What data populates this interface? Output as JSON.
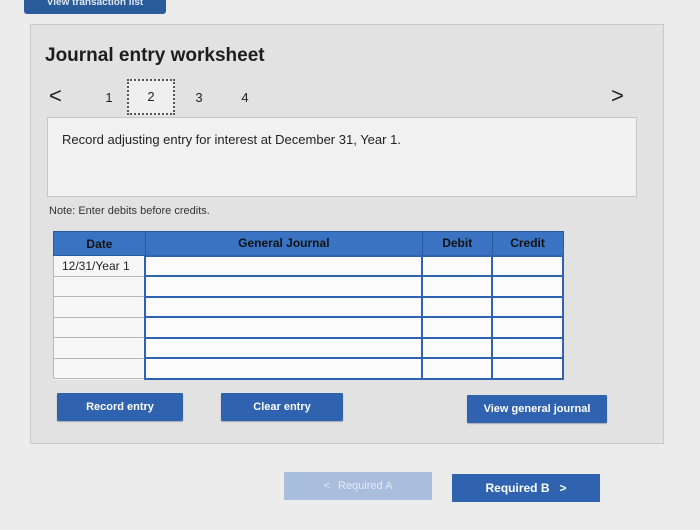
{
  "top_tab": {
    "label": "View transaction list"
  },
  "worksheet": {
    "title": "Journal entry worksheet",
    "nav": {
      "prev_icon": "chevron-left-icon",
      "next_icon": "chevron-right-icon",
      "prev_glyph": "<",
      "next_glyph": ">",
      "steps": [
        "1",
        "2",
        "3",
        "4"
      ],
      "active_step": "2"
    },
    "instruction": "Record adjusting entry for interest at December 31, Year 1.",
    "note": "Note: Enter debits before credits.",
    "table": {
      "headers": {
        "date": "Date",
        "general_journal": "General Journal",
        "debit": "Debit",
        "credit": "Credit"
      },
      "rows": [
        {
          "date": "12/31/Year 1",
          "account": "",
          "debit": "",
          "credit": ""
        },
        {
          "date": "",
          "account": "",
          "debit": "",
          "credit": ""
        },
        {
          "date": "",
          "account": "",
          "debit": "",
          "credit": ""
        },
        {
          "date": "",
          "account": "",
          "debit": "",
          "credit": ""
        },
        {
          "date": "",
          "account": "",
          "debit": "",
          "credit": ""
        },
        {
          "date": "",
          "account": "",
          "debit": "",
          "credit": ""
        }
      ]
    },
    "buttons": {
      "record": "Record entry",
      "clear": "Clear entry",
      "view_journal": "View general journal"
    }
  },
  "footer": {
    "required_a": "Required A",
    "required_b": "Required B",
    "prev_glyph": "<",
    "next_glyph": ">"
  },
  "colors": {
    "accent": "#2f63b0",
    "header": "#3a73c2",
    "disabled": "#a9bddc"
  }
}
